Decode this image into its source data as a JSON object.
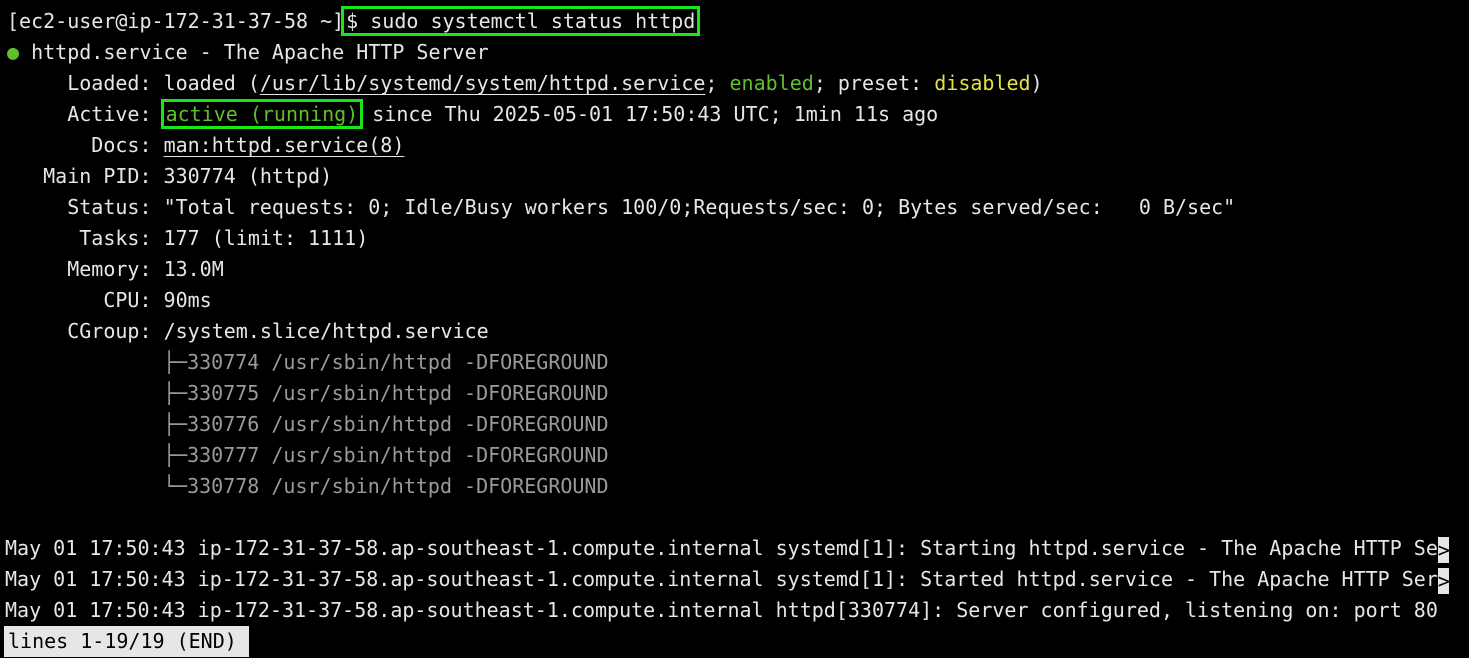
{
  "terminal": {
    "prompt": "[ec2-user@ip-172-31-37-58 ~]",
    "command": "$ sudo systemctl status httpd",
    "service_title": "httpd.service - The Apache HTTP Server",
    "loaded_label": "Loaded:",
    "loaded_value_prefix": "loaded (",
    "loaded_path": "/usr/lib/systemd/system/httpd.service",
    "loaded_sep1": "; ",
    "loaded_enabled": "enabled",
    "loaded_sep2": "; preset: ",
    "loaded_preset": "disabled",
    "loaded_close": ")",
    "active_label": "Active:",
    "active_state": "active (running)",
    "active_since": " since Thu 2025-05-01 17:50:43 UTC; 1min 11s ago",
    "docs_label": "Docs:",
    "docs_value": "man:httpd.service(8)",
    "mainpid_label": "Main PID:",
    "mainpid_value": "330774 (httpd)",
    "status_label": "Status:",
    "status_value": "\"Total requests: 0; Idle/Busy workers 100/0;Requests/sec: 0; Bytes served/sec:   0 B/sec\"",
    "tasks_label": "Tasks:",
    "tasks_value": "177 (limit: 1111)",
    "memory_label": "Memory:",
    "memory_value": "13.0M",
    "cpu_label": "CPU:",
    "cpu_value": "90ms",
    "cgroup_label": "CGroup:",
    "cgroup_value": "/system.slice/httpd.service",
    "processes": [
      "├─330774 /usr/sbin/httpd -DFOREGROUND",
      "├─330775 /usr/sbin/httpd -DFOREGROUND",
      "├─330776 /usr/sbin/httpd -DFOREGROUND",
      "├─330777 /usr/sbin/httpd -DFOREGROUND",
      "└─330778 /usr/sbin/httpd -DFOREGROUND"
    ],
    "logs": [
      "May 01 17:50:43 ip-172-31-37-58.ap-southeast-1.compute.internal systemd[1]: Starting httpd.service - The Apache HTTP Se",
      "May 01 17:50:43 ip-172-31-37-58.ap-southeast-1.compute.internal systemd[1]: Started httpd.service - The Apache HTTP Ser",
      "May 01 17:50:43 ip-172-31-37-58.ap-southeast-1.compute.internal httpd[330774]: Server configured, listening on: port 80"
    ],
    "truncation_marker": ">",
    "pager_status": "lines 1-19/19 (END)"
  },
  "colors": {
    "background": "#000000",
    "text": "#e6e6e6",
    "green": "#5fbf2f",
    "yellow": "#e5e04a",
    "highlight_box": "#19e619"
  }
}
